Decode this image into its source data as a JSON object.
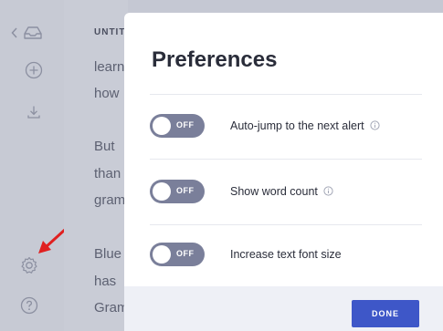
{
  "document": {
    "title": "UNTITLED",
    "lines": [
      "learn",
      "how",
      "But",
      "than",
      "gram",
      "Blue",
      "has",
      "Gram"
    ]
  },
  "rail": {
    "icons": [
      "chevron-left-icon",
      "inbox-icon",
      "add-icon",
      "download-icon",
      "settings-icon",
      "help-icon"
    ]
  },
  "modal": {
    "title": "Preferences",
    "preferences": [
      {
        "label": "Auto-jump to the next alert",
        "state": "OFF",
        "has_info": true
      },
      {
        "label": "Show word count",
        "state": "OFF",
        "has_info": true
      },
      {
        "label": "Increase text font size",
        "state": "OFF",
        "has_info": false
      }
    ],
    "done_label": "DONE"
  },
  "colors": {
    "toggle_off": "#7a7f9a",
    "primary": "#3e57c8",
    "annotation_arrow": "#e02020"
  }
}
